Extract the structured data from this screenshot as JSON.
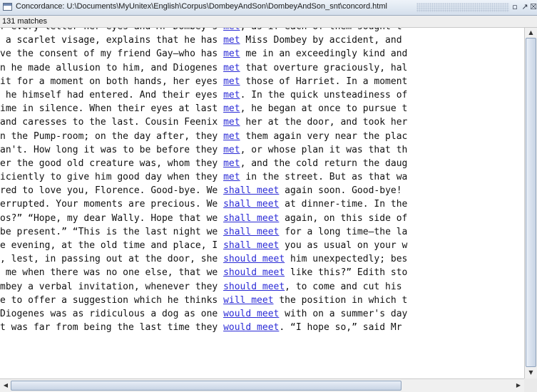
{
  "window": {
    "title": "Concordance: U:\\Documents\\MyUnitex\\English\\Corpus\\DombeyAndSon\\DombeyAndSon_snt\\concord.html",
    "minimize_glyph": "▫",
    "maximize_glyph": "↗",
    "close_glyph": "☒"
  },
  "status": {
    "matches": "131 matches"
  },
  "concordance": {
    "rows": [
      {
        "left": "r every letter her eyes and Mr Dombey's ",
        "match": "met",
        "right": ", as if each of them sought t"
      },
      {
        "left": " a scarlet visage, explains that he has ",
        "match": "met",
        "right": " Miss Dombey by accident, and"
      },
      {
        "left": "ve the consent of my friend Gay—who has ",
        "match": "met",
        "right": " me in an exceedingly kind and"
      },
      {
        "left": "n he made allusion to him, and Diogenes ",
        "match": "met",
        "right": " that overture graciously, hal"
      },
      {
        "left": "it for a moment on both hands, her eyes ",
        "match": "met",
        "right": " those of Harriet. In a moment"
      },
      {
        "left": " he himself had entered. And their eyes ",
        "match": "met",
        "right": ". In the quick unsteadiness of"
      },
      {
        "left": "ime in silence. When their eyes at last ",
        "match": "met",
        "right": ", he began at once to pursue t"
      },
      {
        "left": "and caresses to the last. Cousin Feenix ",
        "match": "met",
        "right": " her at the door, and took her"
      },
      {
        "left": "n the Pump-room; on the day after, they ",
        "match": "met",
        "right": " them again very near the plac"
      },
      {
        "left": "an't. How long it was to be before they ",
        "match": "met",
        "right": ", or whose plan it was that th"
      },
      {
        "left": "er the good old creature was, whom they ",
        "match": "met",
        "right": ", and the cold return the daug"
      },
      {
        "left": "iciently to give him good day when they ",
        "match": "met",
        "right": " in the street. But as that wa"
      },
      {
        "left": "red to love you, Florence. Good-bye. We ",
        "match": "shall meet",
        "right": " again soon. Good-bye!"
      },
      {
        "left": "errupted. Your moments are precious. We ",
        "match": "shall meet",
        "right": " at dinner-time. In the"
      },
      {
        "left": "os?” “Hope, my dear Wally. Hope that we ",
        "match": "shall meet",
        "right": " again, on this side of"
      },
      {
        "left": "be present.” “This is the last night we ",
        "match": "shall meet",
        "right": " for a long time—the la"
      },
      {
        "left": "e evening, at the old time and place, I ",
        "match": "shall meet",
        "right": " you as usual on your w"
      },
      {
        "left": ", lest, in passing out at the door, she ",
        "match": "should meet",
        "right": " him unexpectedly; bes"
      },
      {
        "left": " me when there was no one else, that we ",
        "match": "should meet",
        "right": " like this?” Edith sto"
      },
      {
        "left": "mbey a verbal invitation, whenever they ",
        "match": "should meet",
        "right": ", to come and cut his"
      },
      {
        "left": "e to offer a suggestion which he thinks ",
        "match": "will meet",
        "right": " the position in which t"
      },
      {
        "left": "Diogenes was as ridiculous a dog as one ",
        "match": "would meet",
        "right": " with on a summer's day"
      },
      {
        "left": "t was far from being the last time they ",
        "match": "would meet",
        "right": ". “I hope so,” said Mr"
      }
    ]
  },
  "scroll": {
    "up_arrow": "▲",
    "down_arrow": "▼",
    "left_arrow": "◀",
    "right_arrow": "▶"
  },
  "colors": {
    "link": "#2b2bd6",
    "titlebar": "#d4dfec"
  }
}
